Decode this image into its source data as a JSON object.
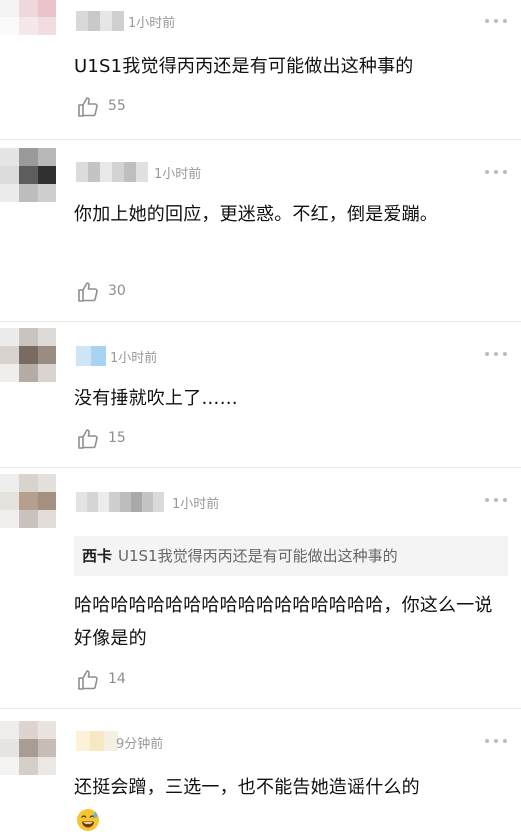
{
  "comments": [
    {
      "time": "1小时前",
      "text": "U1S1我觉得丙丙还是有可能做出这种事的",
      "likes": "55",
      "quote": null
    },
    {
      "time": "1小时前",
      "text": "你加上她的回应，更迷惑。不红，倒是爱蹦。",
      "likes": "30",
      "quote": null
    },
    {
      "time": "1小时前",
      "text": "没有捶就吹上了……",
      "likes": "15",
      "quote": null
    },
    {
      "time": "1小时前",
      "text": "哈哈哈哈哈哈哈哈哈哈哈哈哈哈哈哈哈，你这么一说好像是的",
      "likes": "14",
      "quote": {
        "name": "西卡",
        "text": "U1S1我觉得丙丙还是有可能做出这种事的"
      }
    },
    {
      "time": "9分钟前",
      "text": "还挺会蹭，三选一，也不能告她造谣什么的",
      "likes": null,
      "quote": null,
      "emoji": "grinning-sweat-emoji"
    }
  ],
  "icons": {
    "like": "thumbs-up-outline-icon",
    "more": "more-dots-icon"
  },
  "colors": {
    "meta_gray": "#999999",
    "text": "#111111",
    "quote_bg": "#f4f4f4",
    "divider": "#ececec"
  }
}
